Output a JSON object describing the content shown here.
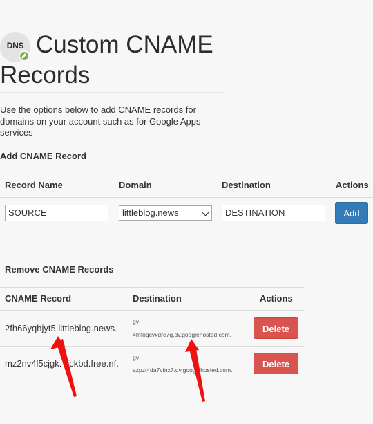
{
  "header": {
    "icon_text": "DNS",
    "title_line1": "Custom CNAME",
    "title_line2": "Records"
  },
  "description": "Use the options below to add CNAME records for domains on your account such as for Google Apps services",
  "add_section": {
    "title": "Add CNAME Record",
    "columns": [
      "Record Name",
      "Domain",
      "Destination",
      "Actions"
    ],
    "record_name_value": "SOURCE",
    "domain_selected": "littleblog.news",
    "destination_value": "DESTINATION",
    "add_label": "Add"
  },
  "remove_section": {
    "title": "Remove CNAME Records",
    "columns": [
      "CNAME Record",
      "Destination",
      "Actions"
    ],
    "rows": [
      {
        "record": "2fh66yqhjyt5.littleblog.news.",
        "dest_line1": "gv-",
        "dest_line2": "4fnfoqcvxdre7q.dv.googlehosted.com.",
        "action": "Delete"
      },
      {
        "record": "mz2nv4l5cjgk.",
        "record_rest": "ickbd.free.nf.",
        "dest_line1": "gv-",
        "dest_line2": "azpzt4da7vfnx7.dv.googlehosted.com.",
        "action": "Delete"
      }
    ]
  },
  "colors": {
    "add_button": "#337ab7",
    "delete_button": "#d9534f",
    "annotation_arrow": "#ee1111"
  }
}
